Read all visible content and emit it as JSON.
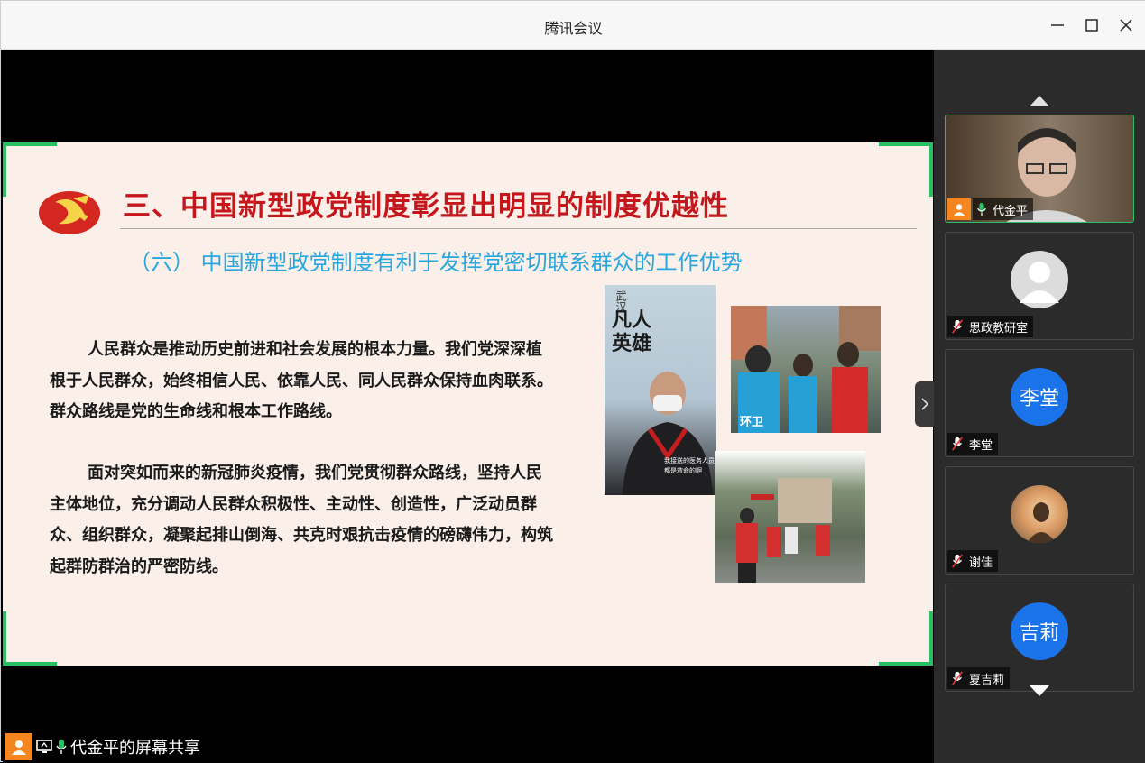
{
  "window": {
    "title": "腾讯会议"
  },
  "slide": {
    "title": "三、中国新型政党制度彰显出明显的制度优越性",
    "subtitle": "（六） 中国新型政党制度有利于发挥党密切联系群众的工作优势",
    "paragraph1": "人民群众是推动历史前进和社会发展的根本力量。我们党深深植根于人民群众，始终相信人民、依靠人民、同人民群众保持血肉联系。群众路线是党的生命线和根本工作路线。",
    "paragraph2": "面对突如而来的新冠肺炎疫情，我们党贯彻群众路线，坚持人民主体地位，充分调动人民群众积极性、主动性、创造性，广泛动员群众、组织群众，凝聚起排山倒海、共克时艰抗击疫情的磅礴伟力，构筑起群防群治的严密防线。",
    "poster": {
      "line1": "武汉",
      "line2": "凡人英雄",
      "caption1": "我接送的医务人员",
      "caption2": "都是救命的啊"
    },
    "photo2_text": "环卫",
    "colors": {
      "title": "#c5161b",
      "subtitle": "#28a7dc",
      "corner": "#2bbf64",
      "background": "#fbefe9"
    }
  },
  "share": {
    "label": "代金平的屏幕共享"
  },
  "participants": [
    {
      "name": "代金平",
      "type": "camera",
      "mic": "on",
      "host": true
    },
    {
      "name": "思政教研室",
      "type": "default-avatar",
      "mic": "off"
    },
    {
      "name": "李堂",
      "initials": "李堂",
      "type": "initials",
      "color": "#1a73e8",
      "mic": "off"
    },
    {
      "name": "谢佳",
      "type": "photo-avatar",
      "mic": "off"
    },
    {
      "name": "夏吉莉",
      "initials": "吉莉",
      "type": "initials",
      "color": "#1a73e8",
      "mic": "off"
    }
  ]
}
